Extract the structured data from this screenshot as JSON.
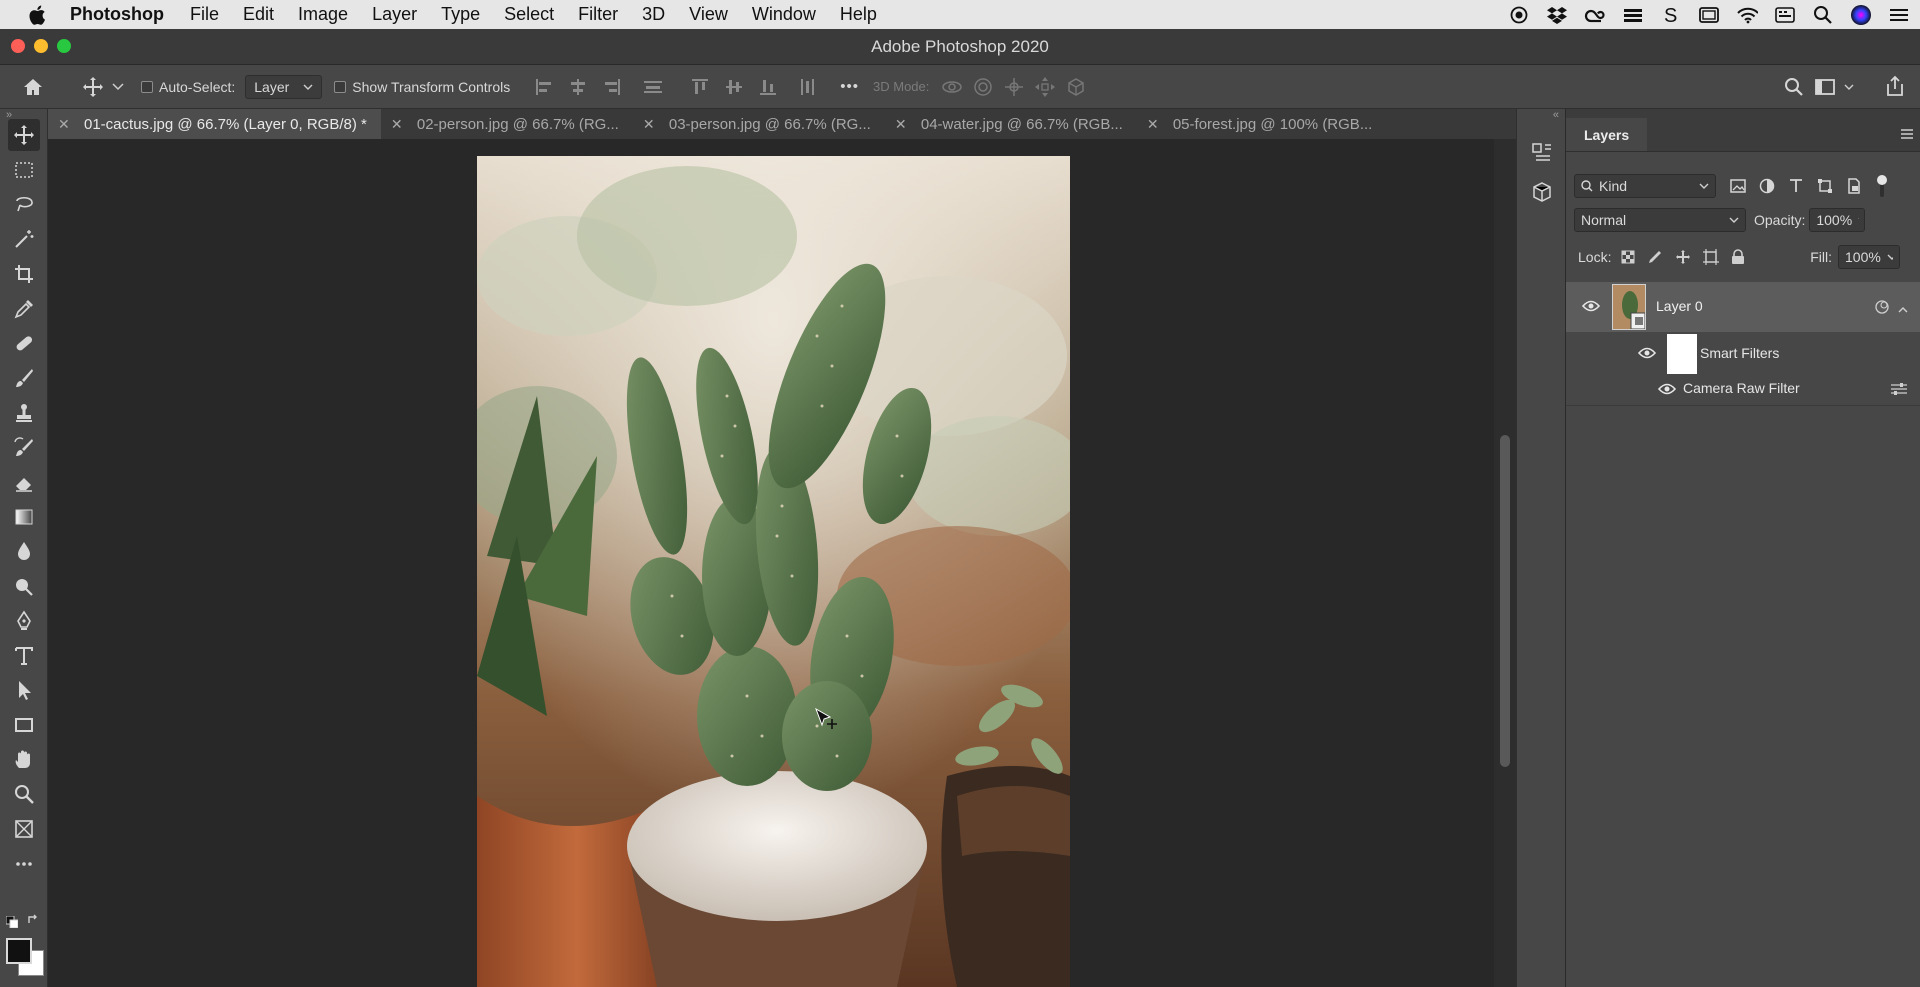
{
  "menubar": {
    "app_name": "Photoshop",
    "items": [
      "File",
      "Edit",
      "Image",
      "Layer",
      "Type",
      "Select",
      "Filter",
      "3D",
      "View",
      "Window",
      "Help"
    ],
    "status_icons": [
      "record-icon",
      "dropbox-icon",
      "creative-cloud-icon",
      "stack-icon",
      "s-icon",
      "display-icon",
      "wifi-icon",
      "keyboard-icon",
      "search-icon",
      "siri-icon",
      "list-icon"
    ]
  },
  "window": {
    "title": "Adobe Photoshop 2020"
  },
  "options_bar": {
    "auto_select_label": "Auto-Select:",
    "auto_select_value": "Layer",
    "show_transform_label": "Show Transform Controls",
    "more_label": "•••",
    "mode_3d_label": "3D Mode:"
  },
  "tabs": [
    {
      "label": "01-cactus.jpg @ 66.7% (Layer 0, RGB/8) *",
      "active": true
    },
    {
      "label": "02-person.jpg @ 66.7% (RG...",
      "active": false
    },
    {
      "label": "03-person.jpg @ 66.7% (RG...",
      "active": false
    },
    {
      "label": "04-water.jpg @ 66.7% (RGB...",
      "active": false
    },
    {
      "label": "05-forest.jpg @ 100% (RGB...",
      "active": false
    }
  ],
  "toolbar": {
    "tools": [
      "move-tool-icon",
      "marquee-tool-icon",
      "lasso-tool-icon",
      "magic-wand-tool-icon",
      "crop-tool-icon",
      "eyedropper-tool-icon",
      "healing-brush-tool-icon",
      "brush-tool-icon",
      "clone-stamp-tool-icon",
      "history-brush-tool-icon",
      "eraser-tool-icon",
      "gradient-tool-icon",
      "blur-tool-icon",
      "dodge-tool-icon",
      "pen-tool-icon",
      "type-tool-icon",
      "path-selection-tool-icon",
      "rectangle-tool-icon",
      "hand-tool-icon",
      "zoom-tool-icon",
      "frame-tool-icon",
      "more-tools-icon"
    ],
    "foreground_color": "#111111",
    "background_color": "#ffffff"
  },
  "layers_panel": {
    "tab_label": "Layers",
    "filter_kind": "Kind",
    "blend_mode": "Normal",
    "opacity_label": "Opacity:",
    "opacity_value": "100%",
    "lock_label": "Lock:",
    "fill_label": "Fill:",
    "fill_value": "100%",
    "layers": [
      {
        "name": "Layer 0",
        "visible": true
      },
      {
        "name": "Smart Filters",
        "visible": true
      },
      {
        "name": "Camera Raw Filter",
        "visible": true
      }
    ]
  },
  "colors": {
    "menubar_bg": "#e6e6e6",
    "panel_bg": "#474747",
    "canvas_bg": "#282828",
    "selected_layer_bg": "#5c5c5c",
    "close_light": "#ff5f57",
    "minimize_light": "#febc2e",
    "zoom_light": "#28c840"
  }
}
